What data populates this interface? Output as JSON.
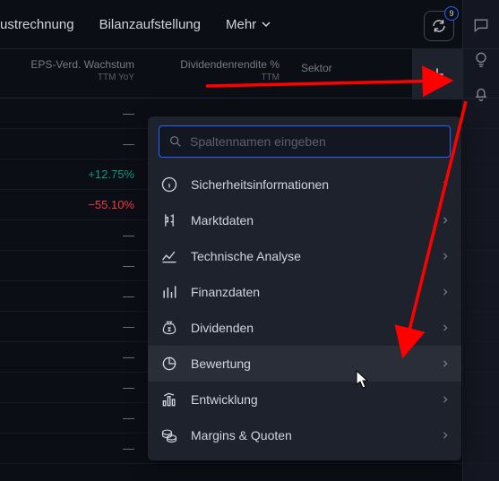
{
  "topnav": {
    "tab1": "ustrechnung",
    "tab2": "Bilanzaufstellung",
    "more": "Mehr"
  },
  "refresh": {
    "badge": "9"
  },
  "columns": {
    "eps": {
      "label": "EPS-Verd. Wachstum",
      "sub": "TTM YoY"
    },
    "div": {
      "label": "Dividendenrendite %",
      "sub": "TTM"
    },
    "sektor": {
      "label": "Sektor"
    }
  },
  "rows": [
    {
      "eps": "—",
      "cls": "val-dash"
    },
    {
      "eps": "—",
      "cls": "val-dash"
    },
    {
      "eps": "+12.75%",
      "cls": "val-pos"
    },
    {
      "eps": "−55.10%",
      "cls": "val-neg"
    },
    {
      "eps": "—",
      "cls": "val-dash"
    },
    {
      "eps": "—",
      "cls": "val-dash"
    },
    {
      "eps": "—",
      "cls": "val-dash"
    },
    {
      "eps": "—",
      "cls": "val-dash"
    },
    {
      "eps": "—",
      "cls": "val-dash"
    },
    {
      "eps": "—",
      "cls": "val-dash"
    },
    {
      "eps": "—",
      "cls": "val-dash"
    },
    {
      "eps": "—",
      "cls": "val-dash"
    }
  ],
  "search": {
    "placeholder": "Spaltennamen eingeben"
  },
  "categories": [
    {
      "label": "Sicherheitsinformationen",
      "icon": "info"
    },
    {
      "label": "Marktdaten",
      "icon": "candles"
    },
    {
      "label": "Technische Analyse",
      "icon": "trend"
    },
    {
      "label": "Finanzdaten",
      "icon": "bars"
    },
    {
      "label": "Dividenden",
      "icon": "moneybag"
    },
    {
      "label": "Bewertung",
      "icon": "pie",
      "active": true
    },
    {
      "label": "Entwicklung",
      "icon": "growth"
    },
    {
      "label": "Margins & Quoten",
      "icon": "coins"
    }
  ]
}
